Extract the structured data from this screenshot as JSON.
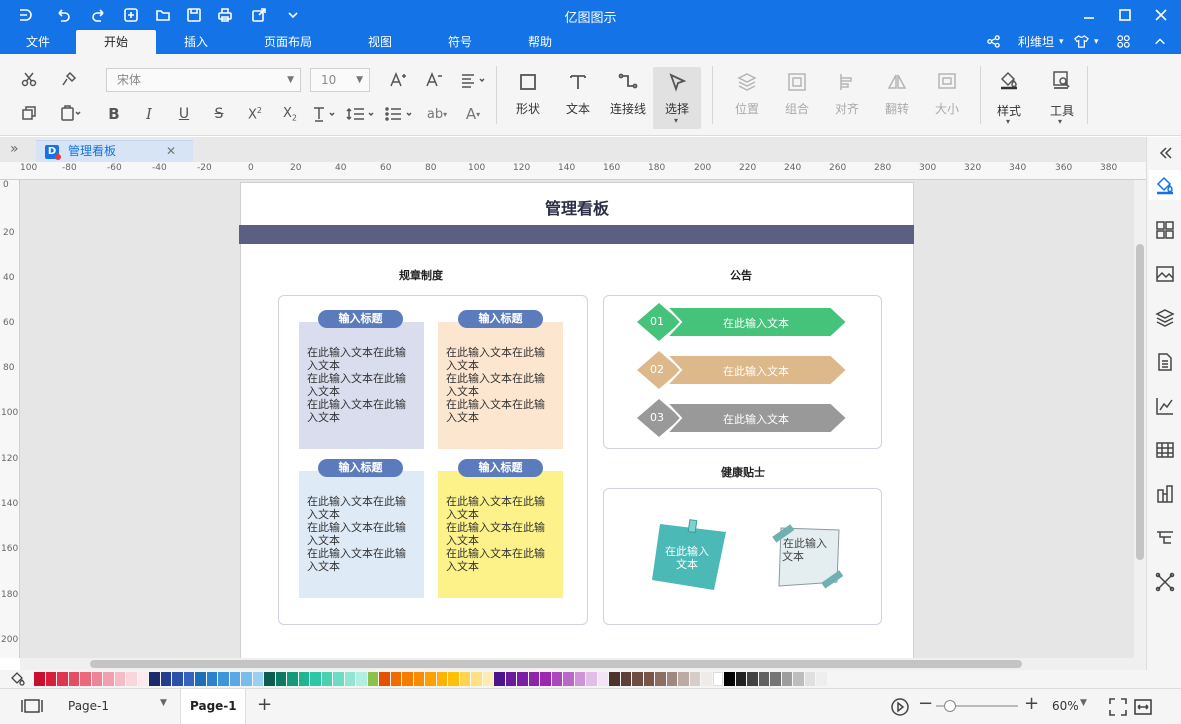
{
  "app": {
    "title": "亿图图示"
  },
  "menu": {
    "items": [
      "文件",
      "开始",
      "插入",
      "页面布局",
      "视图",
      "符号",
      "帮助"
    ],
    "active": "开始",
    "user": "利维坦"
  },
  "ribbon": {
    "font_name": "宋体",
    "font_size": "10",
    "tools": {
      "shape": "形状",
      "text": "文本",
      "connector": "连接线",
      "select": "选择",
      "position": "位置",
      "group": "组合",
      "align": "对齐",
      "flip": "翻转",
      "size": "大小",
      "style": "样式",
      "tools": "工具"
    }
  },
  "tab": {
    "name": "管理看板"
  },
  "rulers": {
    "h": [
      "100",
      "-80",
      "-60",
      "-40",
      "-20",
      "0",
      "20",
      "40",
      "60",
      "80",
      "100",
      "120",
      "140",
      "160",
      "180",
      "200",
      "220",
      "240",
      "260",
      "280",
      "300",
      "320",
      "340",
      "360",
      "380"
    ],
    "v": [
      "0",
      "20",
      "40",
      "60",
      "80",
      "100",
      "120",
      "140",
      "160",
      "180",
      "200"
    ]
  },
  "board": {
    "title": "管理看板",
    "sections": {
      "rules": "规章制度",
      "notice": "公告",
      "health": "健康贴士"
    },
    "sticky_title": "输入标题",
    "sticky_lines": [
      "在此输入文本在此输",
      "入文本",
      "在此输入文本在此输",
      "入文本",
      "在此输入文本在此输",
      "入文本"
    ],
    "notices": [
      {
        "num": "01",
        "text": "在此输入文本",
        "color": "#45c37a"
      },
      {
        "num": "02",
        "text": "在此输入文本",
        "color": "#dcb88a"
      },
      {
        "num": "03",
        "text": "在此输入文本",
        "color": "#999999"
      }
    ],
    "tips": [
      {
        "line1": "在此输入",
        "line2": "文本"
      },
      {
        "line1": "在此输入",
        "line2": "文本"
      }
    ],
    "colors": {
      "header_bar": "#5b6083",
      "sticky1": "#dadded",
      "sticky2": "#fde6cf",
      "sticky3": "#deebf7",
      "sticky4": "#fdf28a",
      "tip1": "#4bb9b6",
      "tip2": "#e4eef0"
    }
  },
  "status": {
    "page_select": "Page-1",
    "page_tab": "Page-1",
    "zoom": "60%"
  },
  "accent": "#1473e6"
}
